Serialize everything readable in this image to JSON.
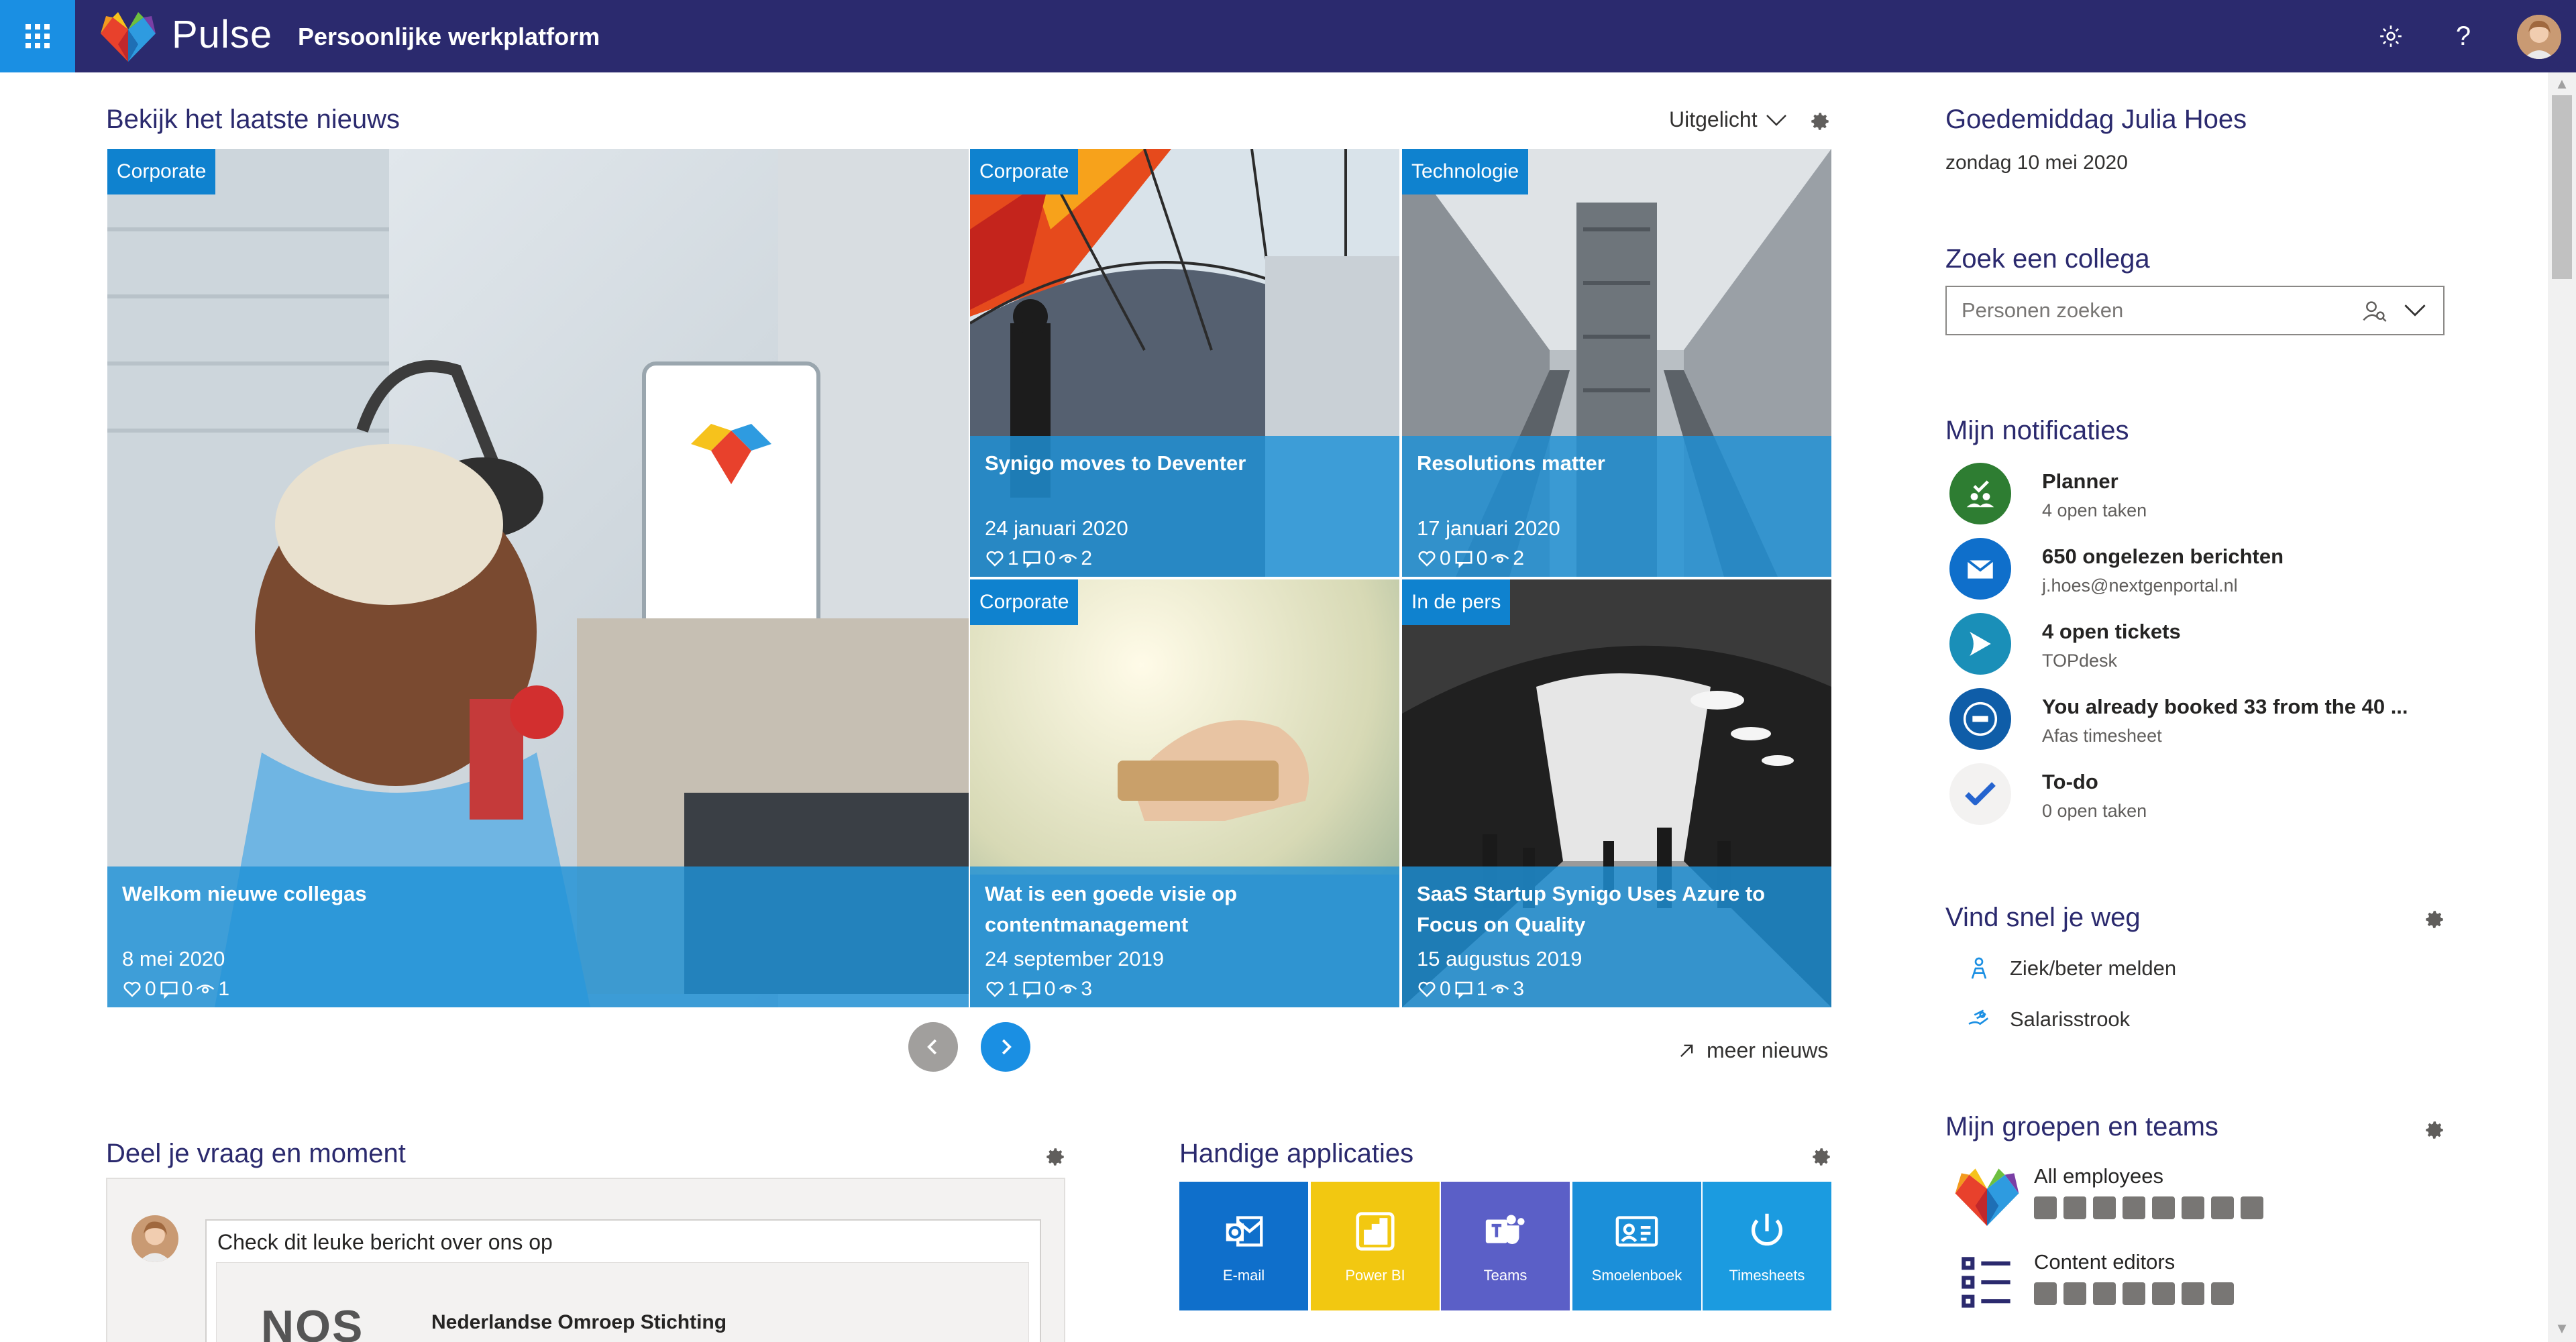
{
  "topbar": {
    "brand": "Pulse",
    "subtitle": "Persoonlijke werkplatform"
  },
  "news": {
    "heading": "Bekijk het laatste nieuws",
    "filter": "Uitgelicht",
    "more": "meer nieuws",
    "items": [
      {
        "tag": "Corporate",
        "title": "Welkom nieuwe collegas",
        "date": "8 mei 2020",
        "likes": "0",
        "comments": "0",
        "views": "1"
      },
      {
        "tag": "Corporate",
        "title": "Synigo moves to Deventer",
        "date": "24 januari 2020",
        "likes": "1",
        "comments": "0",
        "views": "2"
      },
      {
        "tag": "Technologie",
        "title": "Resolutions matter",
        "date": "17 januari 2020",
        "likes": "0",
        "comments": "0",
        "views": "2"
      },
      {
        "tag": "Corporate",
        "title": "Wat is een goede visie op contentmanagement",
        "date": "24 september 2019",
        "likes": "1",
        "comments": "0",
        "views": "3"
      },
      {
        "tag": "In de pers",
        "title": "SaaS Startup Synigo Uses Azure to Focus on Quality",
        "date": "15 augustus 2019",
        "likes": "0",
        "comments": "1",
        "views": "3"
      }
    ]
  },
  "share": {
    "heading": "Deel je vraag en moment",
    "text": "Check dit leuke bericht over ons op",
    "embed_logo": "NOS",
    "embed_title": "Nederlandse Omroep Stichting"
  },
  "apps": {
    "heading": "Handige applicaties",
    "items": [
      {
        "label": "E-mail",
        "color": "#0f6fcb"
      },
      {
        "label": "Power BI",
        "color": "#f2c811"
      },
      {
        "label": "Teams",
        "color": "#5b5fc7"
      },
      {
        "label": "Smoelenboek",
        "color": "#1b8fd9"
      },
      {
        "label": "Timesheets",
        "color": "#1b9be0"
      }
    ]
  },
  "greeting": {
    "name": "Goedemiddag Julia Hoes",
    "date": "zondag 10 mei 2020"
  },
  "colleague": {
    "heading": "Zoek een collega",
    "placeholder": "Personen zoeken"
  },
  "notifications": {
    "heading": "Mijn notificaties",
    "items": [
      {
        "title": "Planner",
        "sub": "4 open taken"
      },
      {
        "title": "650 ongelezen berichten",
        "sub": "j.hoes@nextgenportal.nl"
      },
      {
        "title": "4 open tickets",
        "sub": "TOPdesk"
      },
      {
        "title": "You already booked 33 from the 40 ...",
        "sub": "Afas timesheet"
      },
      {
        "title": "To-do",
        "sub": "0 open taken"
      }
    ]
  },
  "quicklinks": {
    "heading": "Vind snel je weg",
    "items": [
      "Ziek/beter melden",
      "Salarisstrook"
    ]
  },
  "groups": {
    "heading": "Mijn groepen en teams",
    "items": [
      "All employees",
      "Content editors"
    ]
  },
  "colors": {
    "topbar": "#2b2a6e",
    "accent": "#1a8fe3",
    "tag": "#0f82cf"
  }
}
